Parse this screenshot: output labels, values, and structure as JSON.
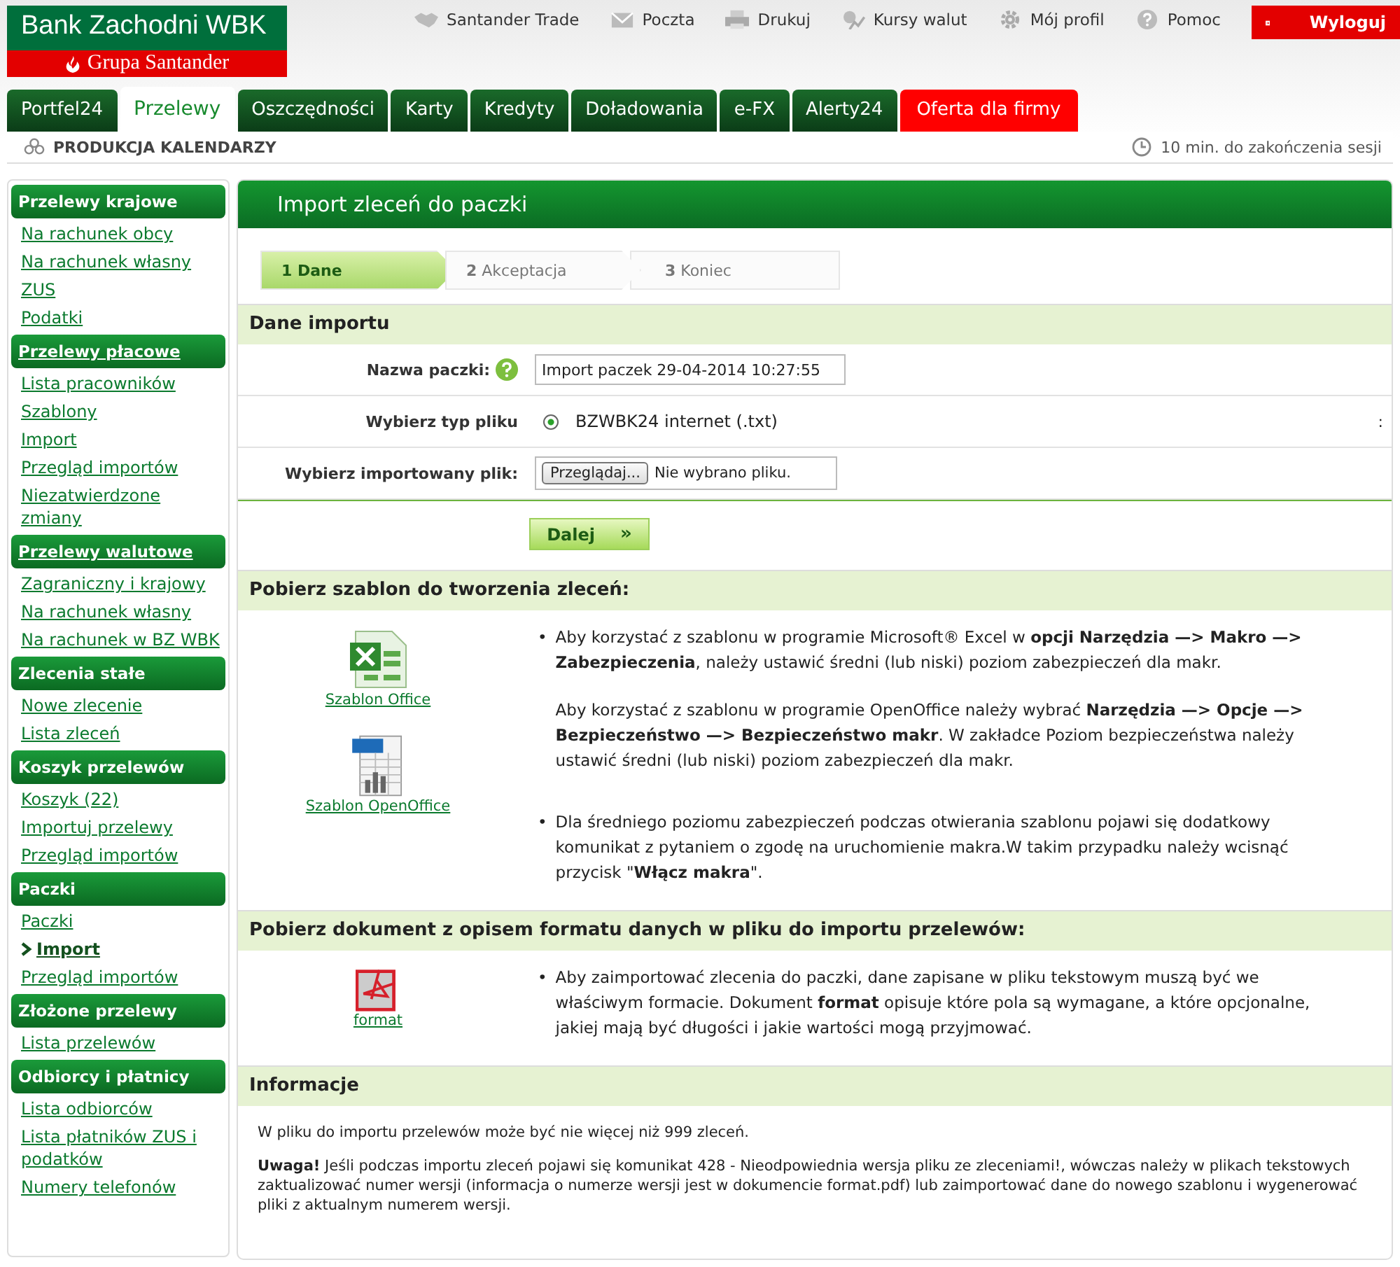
{
  "logo": {
    "name": "Bank Zachodni WBK",
    "group": "Grupa Santander"
  },
  "top_links": [
    {
      "label": "Santander Trade"
    },
    {
      "label": "Poczta"
    },
    {
      "label": "Drukuj"
    },
    {
      "label": "Kursy walut"
    },
    {
      "label": "Mój profil"
    },
    {
      "label": "Pomoc"
    }
  ],
  "logout": "Wyloguj",
  "tabs": [
    {
      "label": "Portfel24",
      "selected": false,
      "kind": "normal"
    },
    {
      "label": "Przelewy",
      "selected": true,
      "kind": "normal"
    },
    {
      "label": "Oszczędności",
      "selected": false,
      "kind": "normal"
    },
    {
      "label": "Karty",
      "selected": false,
      "kind": "normal"
    },
    {
      "label": "Kredyty",
      "selected": false,
      "kind": "normal"
    },
    {
      "label": "Doładowania",
      "selected": false,
      "kind": "normal"
    },
    {
      "label": "e-FX",
      "selected": false,
      "kind": "normal"
    },
    {
      "label": "Alerty24",
      "selected": false,
      "kind": "normal"
    },
    {
      "label": "Oferta dla firmy",
      "selected": false,
      "kind": "promo"
    }
  ],
  "company": "PRODUKCJA KALENDARZY",
  "session": "10 min. do zakończenia sesji",
  "sidebar": [
    {
      "title": "Przelewy krajowe",
      "link": false,
      "items": [
        {
          "label": "Na rachunek obcy",
          "selected": false
        },
        {
          "label": "Na rachunek własny",
          "selected": false
        },
        {
          "label": "ZUS",
          "selected": false
        },
        {
          "label": "Podatki",
          "selected": false
        }
      ]
    },
    {
      "title": "Przelewy płacowe",
      "link": true,
      "items": [
        {
          "label": "Lista pracowników",
          "selected": false
        },
        {
          "label": "Szablony",
          "selected": false
        },
        {
          "label": "Import",
          "selected": false
        },
        {
          "label": "Przegląd importów",
          "selected": false
        },
        {
          "label": "Niezatwierdzone zmiany",
          "selected": false
        }
      ]
    },
    {
      "title": "Przelewy walutowe",
      "link": true,
      "items": [
        {
          "label": "Zagraniczny i krajowy",
          "selected": false
        },
        {
          "label": "Na rachunek własny",
          "selected": false
        },
        {
          "label": "Na rachunek w BZ WBK",
          "selected": false
        }
      ]
    },
    {
      "title": "Zlecenia stałe",
      "link": false,
      "items": [
        {
          "label": "Nowe zlecenie",
          "selected": false
        },
        {
          "label": "Lista zleceń",
          "selected": false
        }
      ]
    },
    {
      "title": "Koszyk przelewów",
      "link": false,
      "items": [
        {
          "label": "Koszyk (22)",
          "selected": false
        },
        {
          "label": "Importuj przelewy",
          "selected": false
        },
        {
          "label": "Przegląd importów",
          "selected": false
        }
      ]
    },
    {
      "title": "Paczki",
      "link": false,
      "items": [
        {
          "label": "Paczki",
          "selected": false
        },
        {
          "label": "Import",
          "selected": true
        },
        {
          "label": "Przegląd importów",
          "selected": false
        }
      ]
    },
    {
      "title": "Złożone przelewy",
      "link": false,
      "items": [
        {
          "label": "Lista przelewów",
          "selected": false
        }
      ]
    },
    {
      "title": "Odbiorcy i płatnicy",
      "link": false,
      "items": [
        {
          "label": "Lista odbiorców",
          "selected": false
        },
        {
          "label": "Lista płatników ZUS i podatków",
          "selected": false
        },
        {
          "label": "Numery telefonów",
          "selected": false
        }
      ]
    }
  ],
  "panel": {
    "title": "Import zleceń do paczki",
    "steps": [
      {
        "number": "1",
        "label": "Dane",
        "selected": true
      },
      {
        "number": "2",
        "label": "Akceptacja",
        "selected": false
      },
      {
        "number": "3",
        "label": "Koniec",
        "selected": false
      }
    ],
    "section_title": "Dane importu",
    "form": [
      {
        "kind": "text",
        "label": "Nazwa paczki:",
        "help": true,
        "value": "Import paczek 29-04-2014 10:27:55"
      },
      {
        "kind": "radio",
        "label": "Wybierz typ pliku",
        "option": "BZWBK24 internet (.txt)",
        "checked": true,
        "note": ":"
      },
      {
        "kind": "file",
        "label": "Wybierz importowany plik:",
        "button": "Przeglądaj...",
        "status": "Nie wybrano pliku."
      }
    ],
    "next_button": "Dalej",
    "next_icon": "»",
    "templates": {
      "title": "Pobierz szablon do tworzenia zleceń:",
      "marker": "•",
      "files": [
        {
          "kind": "excel",
          "label": "Szablon Office"
        },
        {
          "kind": "odf",
          "label": "Szablon OpenOffice"
        }
      ],
      "bullets": [
        [
          "Aby korzystać z szablonu w programie Microsoft® Excel w **opcji Narzędzia —> Makro —> Zabezpieczenia**, należy ustawić średni (lub niski) poziom zabezpieczeń dla makr.",
          "Aby korzystać z szablonu w programie OpenOffice należy wybrać **Narzędzia —> Opcje —> Bezpieczeństwo —> Bezpieczeństwo makr**. W zakładce Poziom bezpieczeństwa należy ustawić średni (lub niski) poziom zabezpieczeń dla makr."
        ],
        [
          "Dla średniego poziomu zabezpieczeń podczas otwierania szablonu pojawi się dodatkowy komunikat z pytaniem o zgodę na uruchomienie makra.W takim przypadku należy wcisnąć przycisk \"**Włącz makra**\"."
        ]
      ]
    },
    "format": {
      "title": "Pobierz dokument z opisem formatu danych w pliku do importu przelewów:",
      "marker": "•",
      "files": [
        {
          "kind": "pdf",
          "label": "format"
        }
      ],
      "bullets": [
        [
          "Aby zaimportować zlecenia do paczki, dane zapisane w pliku tekstowym muszą być we właściwym formacie. Dokument **format** opisuje które pola są wymagane, a które opcjonalne, jakiej mają być długości i jakie wartości mogą przyjmować."
        ]
      ]
    },
    "info": {
      "title": "Informacje",
      "paragraphs": [
        "W pliku do importu przelewów może być nie więcej niż 999 zleceń.",
        "**Uwaga!** Jeśli podczas importu zleceń pojawi się komunikat 428 - Nieodpowiednia wersja pliku ze zleceniami!, wówczas należy w plikach tekstowych zaktualizować numer wersji (informacja o numerze wersji jest w dokumencie format.pdf) lub zaimportować dane do nowego szablonu i wygenerować pliki z aktualnym numerem wersji."
      ]
    }
  }
}
